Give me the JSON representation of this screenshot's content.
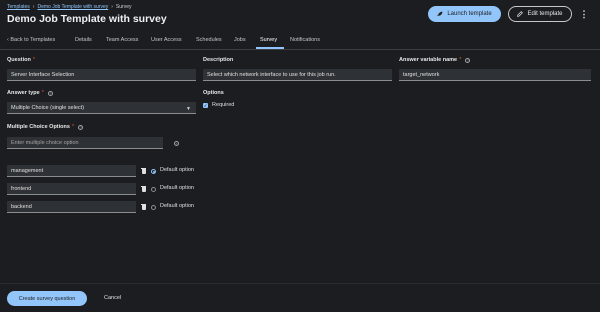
{
  "breadcrumb": {
    "items": [
      "Templates",
      "Demo Job Template with survey",
      "Survey"
    ]
  },
  "header": {
    "title": "Demo Job Template with survey",
    "launch_label": "Launch template",
    "edit_label": "Edit template",
    "kebab_glyph": "⋮"
  },
  "tabs": [
    {
      "label": "‹  Back to Templates"
    },
    {
      "label": "Details"
    },
    {
      "label": "Team Access"
    },
    {
      "label": "User Access"
    },
    {
      "label": "Schedules"
    },
    {
      "label": "Jobs"
    },
    {
      "label": "Survey",
      "active": true
    },
    {
      "label": "Notifications"
    }
  ],
  "form": {
    "question": {
      "label": "Question",
      "required": "*",
      "value": "Server Interface Selection"
    },
    "description": {
      "label": "Description",
      "value": "Select which network interface to use for this job run."
    },
    "variable": {
      "label": "Answer variable name",
      "required": "*",
      "value": "target_network"
    },
    "answer_type": {
      "label": "Answer type",
      "required": "*",
      "value": "Multiple Choice (single select)"
    },
    "options": {
      "label": "Options",
      "required_label": "Required",
      "required_checked": true
    },
    "mc": {
      "label": "Multiple Choice Options",
      "required": "*",
      "new_placeholder": "Enter multiple choice option",
      "default_label": "Default option",
      "items": [
        {
          "value": "management",
          "default": true
        },
        {
          "value": "frontend",
          "default": false
        },
        {
          "value": "backend",
          "default": false
        }
      ]
    }
  },
  "footer": {
    "create_label": "Create survey question",
    "cancel_label": "Cancel"
  },
  "colors": {
    "accent": "#92c5f9",
    "required": "#f0561d",
    "background": "#1b1d21",
    "input_bg": "#2e3236"
  }
}
